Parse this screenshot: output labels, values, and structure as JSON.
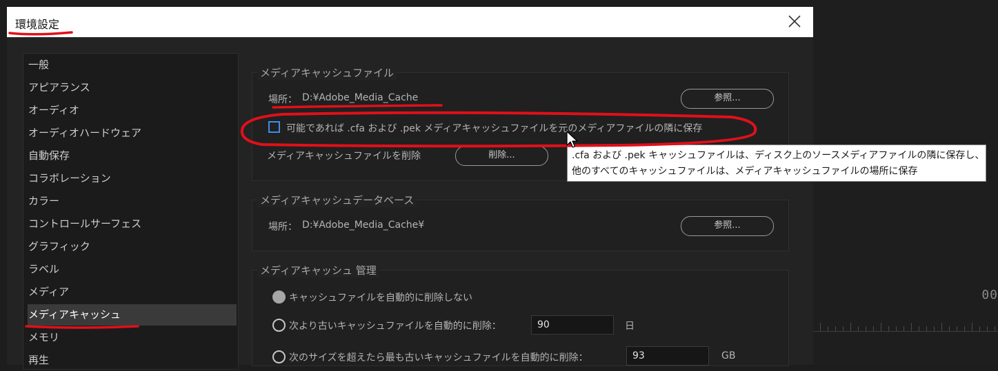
{
  "window": {
    "title": "環境設定"
  },
  "sidebar": {
    "items": [
      {
        "label": "一般"
      },
      {
        "label": "アピアランス"
      },
      {
        "label": "オーディオ"
      },
      {
        "label": "オーディオハードウェア"
      },
      {
        "label": "自動保存"
      },
      {
        "label": "コラボレーション"
      },
      {
        "label": "カラー"
      },
      {
        "label": "コントロールサーフェス"
      },
      {
        "label": "グラフィック"
      },
      {
        "label": "ラベル"
      },
      {
        "label": "メディア"
      },
      {
        "label": "メディアキャッシュ",
        "selected": true
      },
      {
        "label": "メモリ"
      },
      {
        "label": "再生"
      }
    ]
  },
  "cache_files": {
    "title": "メディアキャッシュファイル",
    "location_label": "場所：",
    "location_value": "D:¥Adobe_Media_Cache",
    "browse_label": "参照...",
    "checkbox_label": "可能であれば .cfa および .pek メディアキャッシュファイルを元のメディアファイルの隣に保存",
    "checkbox_checked": false,
    "delete_label": "メディアキャッシュファイルを削除",
    "delete_button": "削除..."
  },
  "cache_db": {
    "title": "メディアキャッシュデータベース",
    "location_label": "場所：",
    "location_value": "D:¥Adobe_Media_Cache¥",
    "browse_label": "参照..."
  },
  "cache_mgmt": {
    "title": "メディアキャッシュ 管理",
    "options": [
      {
        "label": "キャッシュファイルを自動的に削除しない",
        "selected": true
      },
      {
        "label": "次より古いキャッシュファイルを自動的に削除：",
        "value": "90",
        "unit": "日"
      },
      {
        "label": "次のサイズを超えたら最も古いキャッシュファイルを自動的に削除：",
        "value": "93",
        "unit": "GB"
      }
    ]
  },
  "tooltip": {
    "line1": ".cfa および .pek キャッシュファイルは、ディスク上のソースメディアファイルの隣に保存し、",
    "line2": "他のすべてのキャッシュファイルは、メディアキャッシュファイルの場所に保存"
  },
  "timeline": {
    "timecode": "00"
  },
  "colors": {
    "checkbox_border": "#3d8ee8",
    "annotation_red": "#e0101a",
    "dialog_bg": "#232323"
  },
  "icons": {
    "close": "close-icon",
    "cursor": "mouse-pointer-icon"
  }
}
